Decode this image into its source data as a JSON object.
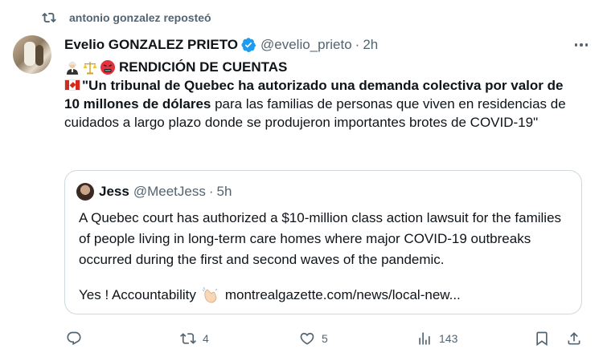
{
  "repost": {
    "text": "antonio gonzalez reposteó",
    "icon": "repost-icon"
  },
  "tweet": {
    "author_name": "Evelio GONZALEZ PRIETO",
    "handle": "@evelio_prieto",
    "separator": "·",
    "time": "2h",
    "verified_color": "#1d9bf0",
    "emoji_title": "RENDICIÓN DE CUENTAS",
    "emoji_icons": [
      "judge-emoji",
      "balance-scale-emoji",
      "angry-face-emoji"
    ],
    "flag": "canada-flag-emoji",
    "bold_text": "\"Un tribunal de Quebec ha autorizado una demanda colectiva por valor de 10 millones de dólares",
    "normal_text": " para las familias de personas que viven en residencias de cuidados a largo plazo donde se produjeron importantes brotes de COVID-19\""
  },
  "quote": {
    "author_name": "Jess",
    "handle": "@MeetJess",
    "separator": "·",
    "time": "5h",
    "text": "A Quebec court has authorized a $10-million class action lawsuit for the families of people living in long-term care homes where major COVID-19 outbreaks occurred during the first and second waves of the pandemic.",
    "footer_prefix": "Yes ! Accountability",
    "footer_emoji": "clapping-hands-emoji",
    "link": "montrealgazette.com/news/local-new..."
  },
  "actions": {
    "reply_count": "",
    "repost_count": "4",
    "like_count": "5",
    "views_count": "143"
  },
  "colors": {
    "secondary_text": "#536471",
    "primary_text": "#0f1419",
    "border": "#cfd9de",
    "accent": "#1d9bf0"
  }
}
